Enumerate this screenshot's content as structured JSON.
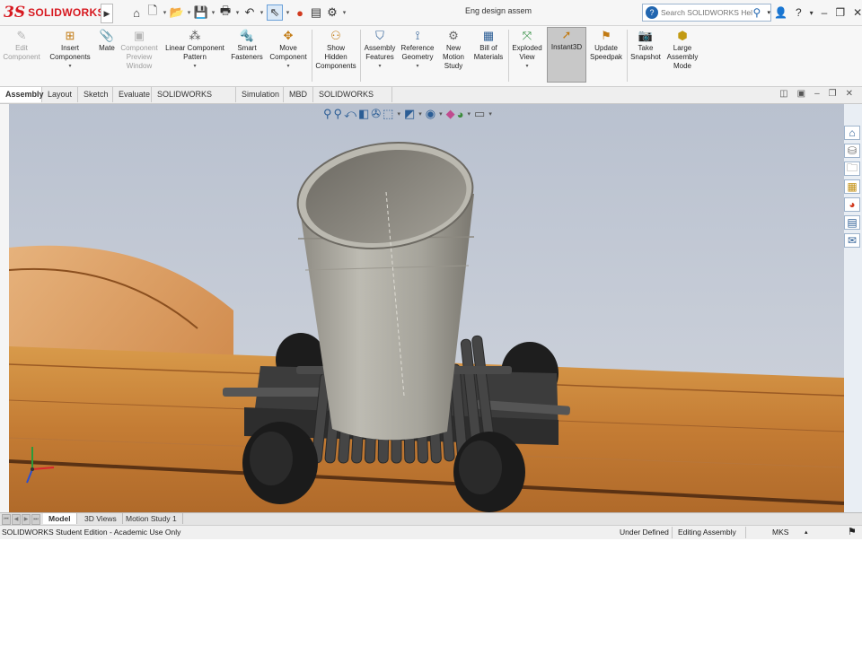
{
  "app": {
    "logo_mark": "3S",
    "logo_text": "SOLIDWORKS",
    "document_title": "Eng design assem"
  },
  "search": {
    "placeholder": "Search SOLIDWORKS Help"
  },
  "quick_access": [
    "home-icon",
    "new-document-icon",
    "open-icon",
    "save-icon",
    "print-icon",
    "undo-icon",
    "select-icon",
    "rebuild-icon",
    "file-properties-icon",
    "options-icon"
  ],
  "command_manager": {
    "buttons": [
      {
        "id": "edit-component",
        "label": [
          "Edit",
          "Component"
        ],
        "disabled": true
      },
      {
        "id": "insert-components",
        "label": [
          "Insert",
          "Components"
        ],
        "disabled": false,
        "caret": true
      },
      {
        "id": "mate",
        "label": [
          "Mate"
        ],
        "disabled": false
      },
      {
        "id": "component-preview-window",
        "label": [
          "Component",
          "Preview",
          "Window"
        ],
        "disabled": true
      },
      {
        "id": "linear-component-pattern",
        "label": [
          "Linear Component",
          "Pattern"
        ],
        "disabled": false,
        "caret": true
      },
      {
        "id": "smart-fasteners",
        "label": [
          "Smart",
          "Fasteners"
        ],
        "disabled": false
      },
      {
        "id": "move-component",
        "label": [
          "Move",
          "Component"
        ],
        "disabled": false,
        "caret": true
      },
      {
        "id": "show-hidden-components",
        "label": [
          "Show",
          "Hidden",
          "Components"
        ],
        "disabled": false
      },
      {
        "id": "assembly-features",
        "label": [
          "Assembly",
          "Features"
        ],
        "disabled": false,
        "caret": true
      },
      {
        "id": "reference-geometry",
        "label": [
          "Reference",
          "Geometry"
        ],
        "disabled": false,
        "caret": true
      },
      {
        "id": "new-motion-study",
        "label": [
          "New",
          "Motion",
          "Study"
        ],
        "disabled": false
      },
      {
        "id": "bill-of-materials",
        "label": [
          "Bill of",
          "Materials"
        ],
        "disabled": false
      },
      {
        "id": "exploded-view",
        "label": [
          "Exploded",
          "View"
        ],
        "disabled": false,
        "caret": true
      },
      {
        "id": "instant3d",
        "label": [
          "Instant3D"
        ],
        "disabled": false,
        "active": true
      },
      {
        "id": "update-speedpak",
        "label": [
          "Update",
          "Speedpak"
        ],
        "disabled": false
      },
      {
        "id": "take-snapshot",
        "label": [
          "Take",
          "Snapshot"
        ],
        "disabled": false
      },
      {
        "id": "large-assembly-mode",
        "label": [
          "Large",
          "Assembly",
          "Mode"
        ],
        "disabled": false
      }
    ]
  },
  "tabs": [
    "Assembly",
    "Layout",
    "Sketch",
    "Evaluate",
    "SOLIDWORKS Add-Ins",
    "Simulation",
    "MBD",
    "SOLIDWORKS CAM"
  ],
  "active_tab": "Assembly",
  "bottom_tabs": [
    "Model",
    "3D Views",
    "Motion Study 1"
  ],
  "active_bottom_tab": "Model",
  "status_bar": {
    "edition": "SOLIDWORKS Student Edition - Academic Use Only",
    "state": "Under Defined",
    "mode": "Editing Assembly",
    "units": "MKS"
  },
  "task_pane_icons": [
    "home-icon",
    "design-library-icon",
    "file-explorer-icon",
    "view-palette-icon",
    "appearances-icon",
    "custom-properties-icon",
    "forum-icon"
  ]
}
